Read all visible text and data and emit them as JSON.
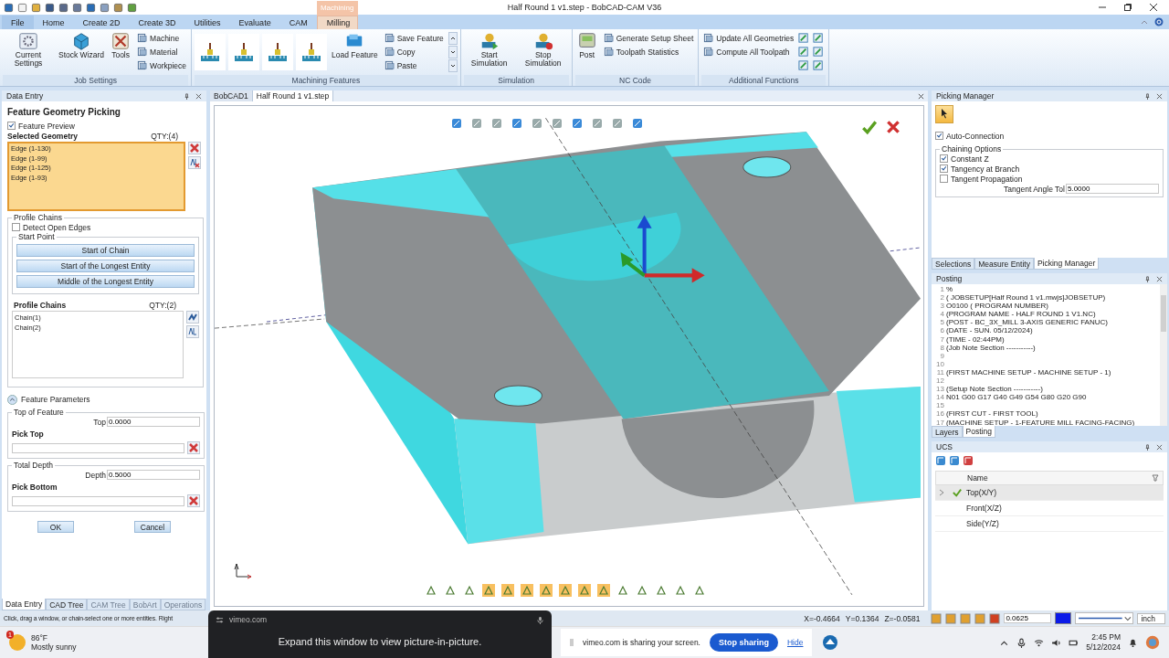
{
  "window": {
    "title": "Half Round 1 v1.step - BobCAD-CAM V36"
  },
  "ribbon_tabs": [
    {
      "label": "File",
      "kind": "menu",
      "selected": false
    },
    {
      "label": "Home",
      "kind": "tab",
      "selected": false
    },
    {
      "label": "Create 2D",
      "kind": "tab",
      "selected": false
    },
    {
      "label": "Create 3D",
      "kind": "tab",
      "selected": false
    },
    {
      "label": "Utilities",
      "kind": "tab",
      "selected": false
    },
    {
      "label": "Evaluate",
      "kind": "tab",
      "selected": false
    },
    {
      "label": "CAM",
      "kind": "tab",
      "selected": false
    },
    {
      "label": "Milling",
      "kind": "tab",
      "selected": true,
      "context": "Machining"
    }
  ],
  "ribbon_groups": [
    {
      "label": "Job Settings",
      "items": [
        {
          "kind": "large",
          "label": "Current Settings"
        },
        {
          "kind": "large",
          "label": "Stock Wizard"
        },
        {
          "kind": "large",
          "label": "Tools"
        },
        {
          "kind": "small",
          "label": "Machine"
        },
        {
          "kind": "small",
          "label": "Material"
        },
        {
          "kind": "small",
          "label": "Workpiece"
        }
      ]
    },
    {
      "label": "Machining Features",
      "items": [
        {
          "kind": "tool"
        },
        {
          "kind": "tool"
        },
        {
          "kind": "tool"
        },
        {
          "kind": "tool"
        },
        {
          "kind": "large",
          "label": "Load Feature"
        },
        {
          "kind": "small",
          "label": "Save Feature"
        },
        {
          "kind": "small",
          "label": "Copy"
        },
        {
          "kind": "small",
          "label": "Paste"
        }
      ]
    },
    {
      "label": "Simulation",
      "items": [
        {
          "kind": "large",
          "label": "Start Simulation"
        },
        {
          "kind": "large",
          "label": "Stop Simulation"
        }
      ]
    },
    {
      "label": "NC Code",
      "items": [
        {
          "kind": "large",
          "label": "Post"
        },
        {
          "kind": "small",
          "label": "Generate Setup Sheet"
        },
        {
          "kind": "small",
          "label": "Toolpath Statistics"
        }
      ]
    },
    {
      "label": "Additional Functions",
      "items": [
        {
          "kind": "small",
          "label": "Update All Geometries"
        },
        {
          "kind": "small",
          "label": "Compute All Toolpath"
        }
      ]
    }
  ],
  "data_entry": {
    "title": "Data Entry",
    "heading": "Feature Geometry Picking",
    "feature_preview": {
      "label": "Feature Preview",
      "checked": true
    },
    "selected_geometry": {
      "label": "Selected Geometry",
      "qty": "QTY:(4)",
      "items": [
        "Edge (1-130)",
        "Edge (1-99)",
        "Edge (1-125)",
        "Edge (1-93)"
      ]
    },
    "profile_chains_group": {
      "label": "Profile Chains",
      "detect_open_edges": {
        "label": "Detect Open Edges",
        "checked": false
      },
      "start_point": {
        "label": "Start Point",
        "buttons": [
          "Start of Chain",
          "Start of the Longest Entity",
          "Middle of the Longest Entity"
        ]
      },
      "list_label": "Profile Chains",
      "qty": "QTY:(2)",
      "items": [
        "Chain(1)",
        "Chain(2)"
      ]
    },
    "feature_parameters": {
      "label": "Feature Parameters",
      "expanded": true
    },
    "top_of_feature": {
      "label": "Top of Feature",
      "field_label": "Top",
      "value": "0.0000",
      "pick_label": "Pick Top"
    },
    "total_depth": {
      "label": "Total Depth",
      "field_label": "Depth",
      "value": "0.5000",
      "pick_label": "Pick Bottom"
    },
    "buttons": [
      "OK",
      "Cancel"
    ],
    "tabs": [
      {
        "label": "Data Entry",
        "selected": true,
        "disabled": false
      },
      {
        "label": "CAD Tree",
        "selected": false,
        "disabled": false
      },
      {
        "label": "CAM Tree",
        "selected": false,
        "disabled": true
      },
      {
        "label": "BobArt",
        "selected": false,
        "disabled": true
      },
      {
        "label": "Operations",
        "selected": false,
        "disabled": true
      }
    ]
  },
  "document_tabs": [
    {
      "label": "BobCAD1",
      "selected": false
    },
    {
      "label": "Half Round 1 v1.step",
      "selected": true
    }
  ],
  "picking_manager": {
    "title": "Picking Manager",
    "auto_connection": {
      "label": "Auto-Connection",
      "checked": true
    },
    "chaining_options": {
      "label": "Chaining Options",
      "options": [
        {
          "label": "Constant Z",
          "checked": true
        },
        {
          "label": "Tangency at Branch",
          "checked": true
        },
        {
          "label": "Tangent Propagation",
          "checked": false
        }
      ],
      "tolerance_label": "Tangent Angle Tol",
      "tolerance_value": "5.0000"
    },
    "tabs": [
      {
        "label": "Selections",
        "selected": false
      },
      {
        "label": "Measure Entity",
        "selected": false
      },
      {
        "label": "Picking Manager",
        "selected": true
      }
    ]
  },
  "posting": {
    "title": "Posting",
    "lines": [
      {
        "number": "1",
        "text": "%"
      },
      {
        "number": "2",
        "text": "( JOBSETUP[Half Round 1 v1.mwjs]JOBSETUP)"
      },
      {
        "number": "3",
        "text": "O0100 ( PROGRAM NUMBER)"
      },
      {
        "number": "4",
        "text": "(PROGRAM NAME - HALF ROUND 1 V1.NC)"
      },
      {
        "number": "5",
        "text": "(POST -  BC_3X_MILL 3-AXIS GENERIC FANUC)"
      },
      {
        "number": "6",
        "text": "(DATE - SUN. 05/12/2024)"
      },
      {
        "number": "7",
        "text": "(TIME - 02:44PM)"
      },
      {
        "number": "8",
        "text": "(Job Note Section -----------)"
      },
      {
        "number": "9"
      },
      {
        "number": "10"
      },
      {
        "number": "11",
        "text": "(FIRST MACHINE SETUP - MACHINE SETUP - 1)"
      },
      {
        "number": "12"
      },
      {
        "number": "13",
        "text": "(Setup Note Section -----------)"
      },
      {
        "number": "14",
        "text": "N01 G00 G17 G40 G49 G54 G80 G20 G90"
      },
      {
        "number": "15"
      },
      {
        "number": "16",
        "text": "(FIRST CUT - FIRST TOOL)"
      },
      {
        "number": "17",
        "text": "(MACHINE SETUP - 1-FEATURE MILL FACING-FACING)"
      }
    ],
    "tabs": [
      {
        "label": "Layers",
        "selected": false
      },
      {
        "label": "Posting",
        "selected": true
      }
    ]
  },
  "ucs": {
    "title": "UCS",
    "column": "Name",
    "rows": [
      {
        "name": "Top(X/Y)",
        "active": true,
        "selected": true
      },
      {
        "name": "Front(X/Z)",
        "active": false,
        "selected": false
      },
      {
        "name": "Side(Y/Z)",
        "active": false,
        "selected": false
      }
    ]
  },
  "status_bar": {
    "message": "Click, drag a window, or chain-select one or more entities. Right",
    "x": "X=-0.4664",
    "y": "Y=0.1364",
    "z": "Z=-0.0581",
    "value": "0.0625",
    "unit": "inch"
  },
  "pip_popup": {
    "site": "vimeo.com",
    "message": "Expand this window to view picture-in-picture."
  },
  "taskbar": {
    "weather_badge": "1",
    "temperature": "86°F",
    "weather": "Mostly sunny",
    "sharing_message": "vimeo.com is sharing your screen.",
    "stop_button": "Stop sharing",
    "hide_link": "Hide",
    "time": "2:45 PM",
    "date": "5/12/2024"
  }
}
